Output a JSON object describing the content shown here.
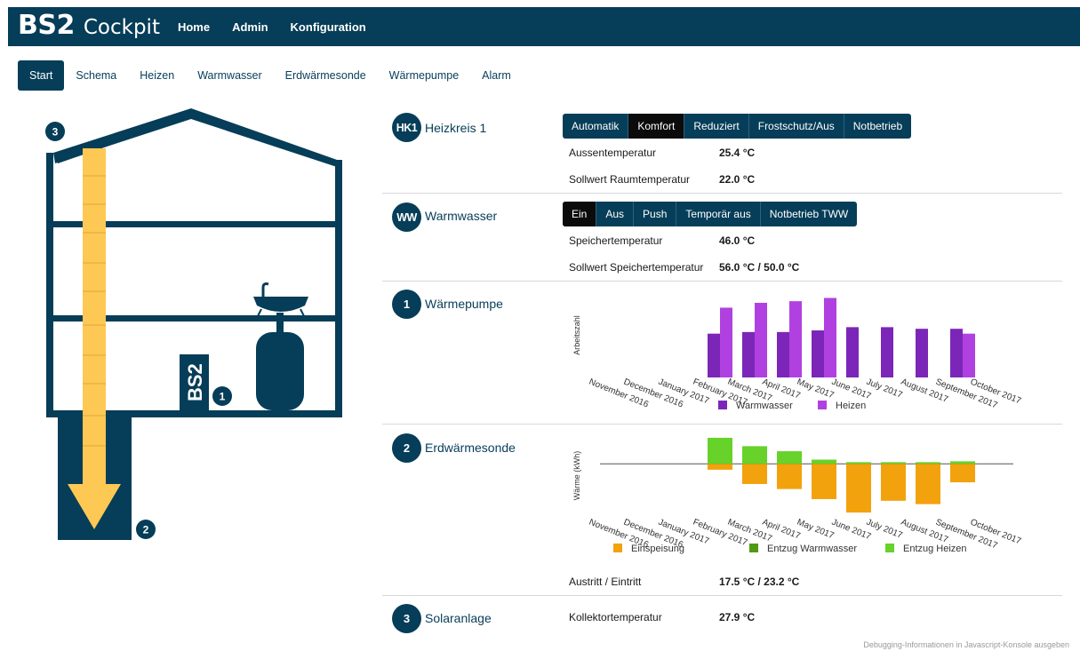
{
  "app": {
    "brand": "BS2",
    "name": "Cockpit"
  },
  "topnav": [
    "Home",
    "Admin",
    "Konfiguration"
  ],
  "tabs": [
    {
      "label": "Start",
      "active": true
    },
    {
      "label": "Schema",
      "active": false
    },
    {
      "label": "Heizen",
      "active": false
    },
    {
      "label": "Warmwasser",
      "active": false
    },
    {
      "label": "Erdwärmesonde",
      "active": false
    },
    {
      "label": "Wärmepumpe",
      "active": false
    },
    {
      "label": "Alarm",
      "active": false
    }
  ],
  "house": {
    "device_label": "BS2",
    "markers": [
      "1",
      "2",
      "3"
    ]
  },
  "colors": {
    "primary": "#063d58",
    "accent_yellow": "#fdc854",
    "purple_dark": "#7b26b8",
    "purple_light": "#b041e0",
    "orange": "#f2a20c",
    "green_dark": "#4f9a12",
    "green_light": "#66d22a"
  },
  "hk1": {
    "badge": "HK1",
    "title": "Heizkreis 1",
    "modes": [
      "Automatik",
      "Komfort",
      "Reduziert",
      "Frostschutz/Aus",
      "Notbetrieb"
    ],
    "selected": 1,
    "rows": [
      {
        "label": "Aussentemperatur",
        "value": "25.4 °C"
      },
      {
        "label": "Sollwert Raumtemperatur",
        "value": "22.0 °C"
      }
    ]
  },
  "ww": {
    "badge": "WW",
    "title": "Warmwasser",
    "modes": [
      "Ein",
      "Aus",
      "Push",
      "Temporär aus",
      "Notbetrieb TWW"
    ],
    "selected": 0,
    "rows": [
      {
        "label": "Speichertemperatur",
        "value": "46.0 °C"
      },
      {
        "label": "Sollwert Speichertemperatur",
        "value": "56.0 °C / 50.0 °C"
      }
    ]
  },
  "wp": {
    "badge": "1",
    "title": "Wärmepumpe"
  },
  "ews": {
    "badge": "2",
    "title": "Erdwärmesonde",
    "rows": [
      {
        "label": "Austritt / Eintritt",
        "value": "17.5 °C / 23.2 °C"
      }
    ]
  },
  "solar": {
    "badge": "3",
    "title": "Solaranlage",
    "rows": [
      {
        "label": "Kollektortemperatur",
        "value": "27.9 °C"
      }
    ]
  },
  "chart_data": [
    {
      "type": "bar",
      "ylabel": "Arbeitszahl",
      "categories": [
        "November 2016",
        "December 2016",
        "January 2017",
        "February 2017",
        "March 2017",
        "April 2017",
        "May 2017",
        "June 2017",
        "July 2017",
        "August 2017",
        "September 2017",
        "October 2017"
      ],
      "series": [
        {
          "name": "Warmwasser",
          "color": "#7b26b8",
          "values": [
            null,
            null,
            2.7,
            2.8,
            2.8,
            2.9,
            3.1,
            3.1,
            3.0,
            3.0,
            null,
            null
          ]
        },
        {
          "name": "Heizen",
          "color": "#b041e0",
          "values": [
            null,
            null,
            4.3,
            4.6,
            4.7,
            4.9,
            null,
            null,
            null,
            2.7,
            null,
            null
          ]
        }
      ],
      "ylim": [
        0,
        5.2
      ],
      "grid": false,
      "legend": "bottom"
    },
    {
      "type": "bar",
      "ylabel": "Wärme (kWh)",
      "categories": [
        "November 2016",
        "December 2016",
        "January 2017",
        "February 2017",
        "March 2017",
        "April 2017",
        "May 2017",
        "June 2017",
        "July 2017",
        "August 2017",
        "September 2017",
        "October 2017"
      ],
      "stacked": true,
      "series": [
        {
          "name": "Einspeisung",
          "color": "#f2a20c",
          "values": [
            null,
            null,
            -7,
            -24,
            -30,
            -42,
            -58,
            -44,
            -48,
            -22,
            null,
            null
          ]
        },
        {
          "name": "Entzug Warmwasser",
          "color": "#4f9a12",
          "values": [
            null,
            null,
            0,
            0,
            0,
            0,
            0,
            0,
            0,
            0,
            null,
            null
          ]
        },
        {
          "name": "Entzug Heizen",
          "color": "#66d22a",
          "values": [
            null,
            null,
            31,
            21,
            15,
            5,
            2,
            2,
            2,
            3,
            null,
            null
          ]
        }
      ],
      "ylim": [
        -60,
        32
      ],
      "grid": false,
      "legend": "bottom"
    }
  ]
}
